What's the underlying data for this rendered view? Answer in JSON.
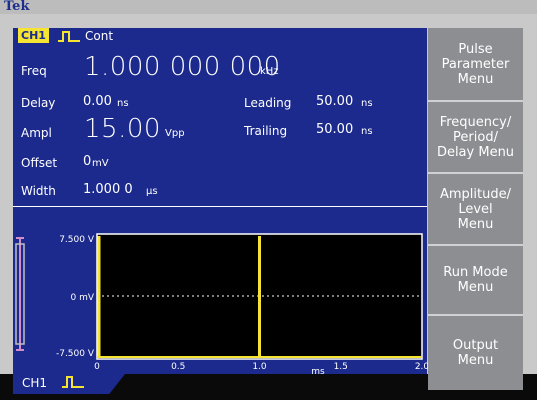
{
  "brand": "Tek",
  "channel": {
    "badge": "CH1",
    "mode": "Cont"
  },
  "params": {
    "freq": {
      "label": "Freq",
      "value": "1.000 000 000",
      "unit": "kHz"
    },
    "delay": {
      "label": "Delay",
      "value": "0.00",
      "unit": "ns"
    },
    "ampl": {
      "label": "Ampl",
      "value": "15.00",
      "unit": "Vpp"
    },
    "offset": {
      "label": "Offset",
      "value": "0",
      "unit": "mV"
    },
    "width": {
      "label": "Width",
      "value": "1.000 0",
      "unit": "µs"
    },
    "leading": {
      "label": "Leading",
      "value": "50.00",
      "unit": "ns"
    },
    "trailing": {
      "label": "Trailing",
      "value": "50.00",
      "unit": "ns"
    }
  },
  "waveform": {
    "y_top": "7.500 V",
    "y_mid": "0 mV",
    "y_bottom": "-7.500 V",
    "x_ticks": [
      "0",
      "0.5",
      "1.0",
      "1.5",
      "2.0"
    ],
    "x_unit": "ms",
    "pulses_at_ms": [
      0,
      1.0
    ],
    "x_range_ms": [
      0,
      2.0
    ]
  },
  "side_menu": [
    {
      "label": "Pulse\nParameter\nMenu"
    },
    {
      "label": "Frequency/\nPeriod/\nDelay Menu"
    },
    {
      "label": "Amplitude/\nLevel\nMenu"
    },
    {
      "label": "Run Mode\nMenu"
    },
    {
      "label": "Output\nMenu"
    }
  ],
  "bottom_tab": "CH1",
  "colors": {
    "screen_bg": "#1b2a8c",
    "trace": "#f5e431",
    "menu_bg": "#8c8e92",
    "marker": "#d28cc8"
  }
}
